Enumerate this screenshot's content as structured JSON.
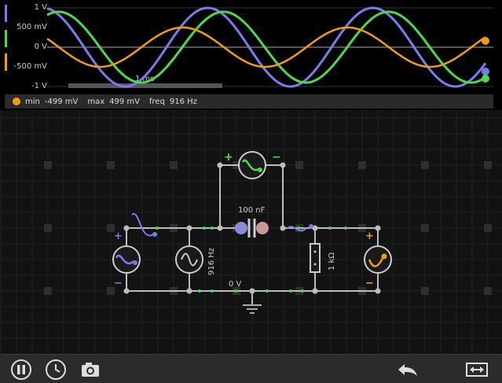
{
  "scope": {
    "y_labels": [
      "1 V",
      "500 mV",
      "0 V",
      "-500 mV",
      "-1 V"
    ],
    "time_label": "1 ms",
    "colors": {
      "ch1": "#7b7bef",
      "ch2": "#4cd94c",
      "ch3": "#f39c12",
      "grid": "#444444"
    }
  },
  "info": {
    "min_label": "min",
    "min_value": "-499 mV",
    "max_label": "max",
    "max_value": "499 mV",
    "freq_label": "freq",
    "freq_value": "916 Hz"
  },
  "circuit": {
    "capacitor_label": "100 nF",
    "resistor_label": "1 kΩ",
    "source_label": "916 Hz",
    "ground_label": "0 V",
    "plus": "+",
    "minus": "−"
  },
  "toolbar": {
    "icons": [
      "pause-icon",
      "clock-icon",
      "camera-icon",
      "undo-icon",
      "fit-icon"
    ]
  }
}
